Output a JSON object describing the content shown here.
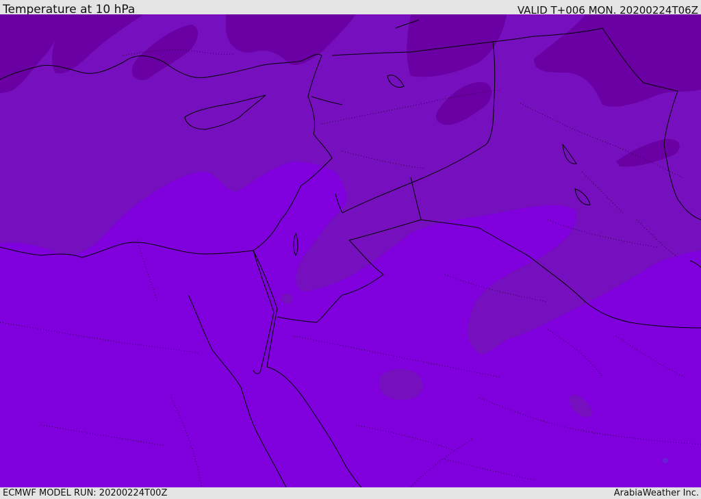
{
  "header": {
    "title": "Temperature at 10 hPa",
    "valid": "VALID T+006 MON. 20200224T06Z"
  },
  "footer": {
    "model_run": "ECMWF MODEL RUN: 20200224T00Z",
    "credit": "ArabiaWeather Inc."
  },
  "colors": {
    "band_warm": "#7f00dd",
    "band_mid": "#760fbd",
    "band_cool": "#6a00a3",
    "coastline": "#000000",
    "border_dotted": "#2a0040"
  }
}
